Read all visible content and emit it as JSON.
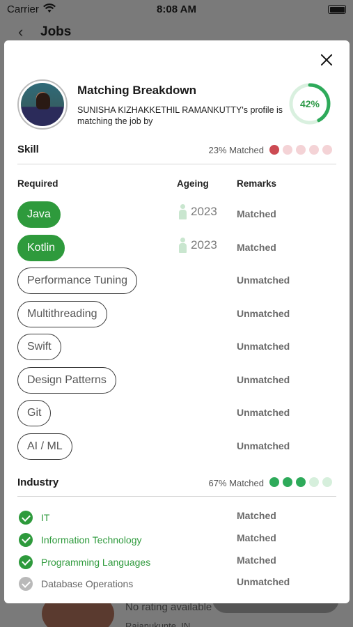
{
  "status_bar": {
    "carrier": "Carrier",
    "time": "8:08 AM"
  },
  "nav": {
    "back_glyph": "‹",
    "title": "Jobs"
  },
  "background": {
    "rating_text": "No rating available",
    "location_text": "Rajanukunte, IN"
  },
  "modal": {
    "title": "Matching Breakdown",
    "subtitle": "SUNISHA KIZHAKKETHIL RAMANKUTTY's profile is matching the job by",
    "match_percent_label": "42%",
    "match_fraction": 0.42,
    "skill": {
      "title": "Skill",
      "matched_label": "23% Matched",
      "dots": [
        "#cc4a52",
        "#f4d3d6",
        "#f4d3d6",
        "#f4d3d6",
        "#f4d3d6"
      ],
      "columns": {
        "required": "Required",
        "ageing": "Ageing",
        "remarks": "Remarks"
      },
      "rows": [
        {
          "name": "Java",
          "matched": true,
          "ageing": "2023",
          "remark": "Matched"
        },
        {
          "name": "Kotlin",
          "matched": true,
          "ageing": "2023",
          "remark": "Matched"
        },
        {
          "name": "Performance Tuning",
          "matched": false,
          "ageing": "",
          "remark": "Unmatched"
        },
        {
          "name": "Multithreading",
          "matched": false,
          "ageing": "",
          "remark": "Unmatched"
        },
        {
          "name": "Swift",
          "matched": false,
          "ageing": "",
          "remark": "Unmatched"
        },
        {
          "name": "Design Patterns",
          "matched": false,
          "ageing": "",
          "remark": "Unmatched"
        },
        {
          "name": "Git",
          "matched": false,
          "ageing": "",
          "remark": "Unmatched"
        },
        {
          "name": "AI / ML",
          "matched": false,
          "ageing": "",
          "remark": "Unmatched"
        }
      ]
    },
    "industry": {
      "title": "Industry",
      "matched_label": "67% Matched",
      "dots": [
        "#2eaa5a",
        "#2eaa5a",
        "#2eaa5a",
        "#d6efdc",
        "#d6efdc"
      ],
      "rows": [
        {
          "name": "IT",
          "matched": true,
          "remark": "Matched"
        },
        {
          "name": "Information Technology",
          "matched": true,
          "remark": "Matched"
        },
        {
          "name": "Programming Languages",
          "matched": true,
          "remark": "Matched"
        },
        {
          "name": "Database Operations",
          "matched": false,
          "remark": "Unmatched"
        }
      ]
    }
  },
  "colors": {
    "accent_green": "#2e9a3c",
    "ring_green": "#2eaa5a",
    "skill_red": "#cc4a52"
  }
}
